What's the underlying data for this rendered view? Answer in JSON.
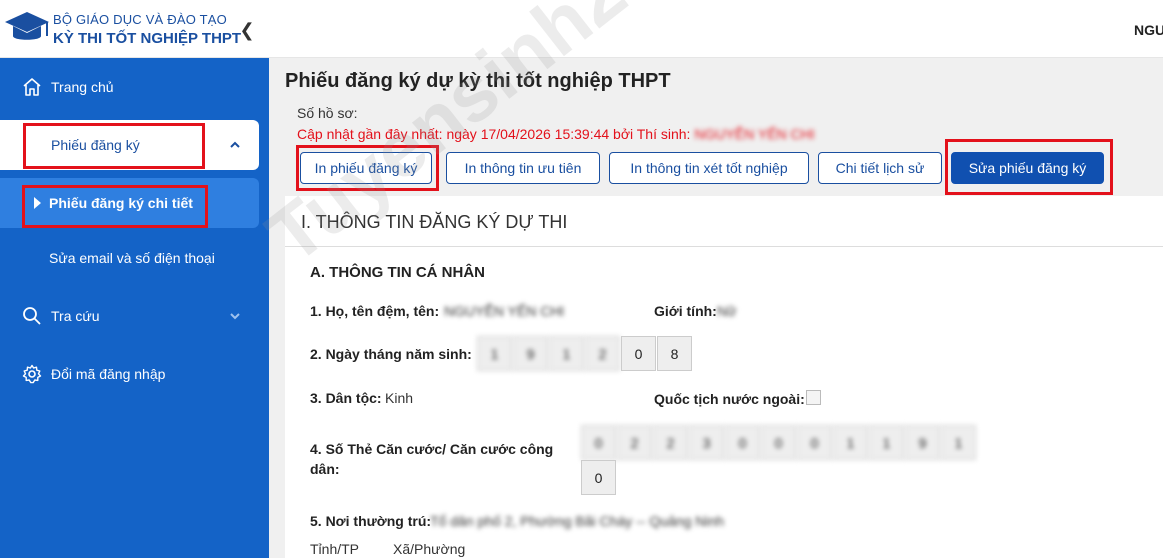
{
  "header": {
    "brand_line1": "BỘ GIÁO DỤC VÀ ĐÀO TẠO",
    "brand_line2": "KỲ THI TỐT NGHIỆP THPT",
    "user_name": "NGU"
  },
  "sidebar": {
    "items": [
      {
        "label": "Trang chủ",
        "icon": "home-icon"
      },
      {
        "label": "Phiếu đăng ký",
        "icon": "chevron-up-icon"
      },
      {
        "label": "Phiếu đăng ký chi tiết",
        "icon": "caret-right-icon"
      },
      {
        "label": "Sửa email và số điện thoại"
      },
      {
        "label": "Tra cứu",
        "icon": "search-icon"
      },
      {
        "label": "Đổi mã đăng nhập",
        "icon": "gear-icon"
      }
    ]
  },
  "main": {
    "title": "Phiếu đăng ký dự kỳ thi tốt nghiệp THPT",
    "ho_so_label": "Số hồ sơ:",
    "cap_nhat": "Cập nhật gần đây nhất: ngày 17/04/2026 15:39:44 bởi Thí sinh:",
    "cap_nhat_name": "NGUYỄN YẾN CHI",
    "buttons": {
      "in_phieu": "In phiếu đăng ký",
      "in_uu_tien": "In thông tin ưu tiên",
      "in_xet_tn": "In thông tin xét tốt nghiệp",
      "chi_tiet_ls": "Chi tiết lịch sử",
      "sua_phieu": "Sửa phiếu đăng ký"
    },
    "section_title": "I. THÔNG TIN ĐĂNG KÝ DỰ THI",
    "sub_title": "A. THÔNG TIN CÁ NHÂN",
    "fields": {
      "ho_ten_label": "1. Họ, tên đệm, tên:",
      "ho_ten_value": "NGUYỄN YẾN CHI",
      "gioi_tinh_label": "Giới tính:",
      "gioi_tinh_value": "Nữ",
      "ngay_sinh_label": "2. Ngày tháng năm sinh:",
      "ngay_sinh_digits": [
        "1",
        "9",
        "1",
        "2",
        "0",
        "8"
      ],
      "dan_toc_label": "3. Dân tộc:",
      "dan_toc_value": "Kinh",
      "quoc_tich_label": "Quốc tịch nước ngoài:",
      "cccd_label_1": "4. Số Thẻ Căn cước/ Căn cước công",
      "cccd_label_2": "dân:",
      "cccd_digits": [
        "0",
        "2",
        "2",
        "3",
        "0",
        "0",
        "0",
        "1",
        "1",
        "9",
        "1",
        "0"
      ],
      "thuong_tru_label": "5. Nơi thường trú:",
      "thuong_tru_value": "Tổ dân phố 2, Phường Bãi Cháy -- Quảng Ninh",
      "tinh_tp_label": "Tỉnh/TP",
      "xa_phuong_label": "Xã/Phường"
    }
  },
  "watermark": "Tuyensinh247.com",
  "colors": {
    "sidebar_bg": "#1463c7",
    "primary": "#1050b0",
    "highlight_red": "#e3111b",
    "brand": "#1a4fa0"
  }
}
